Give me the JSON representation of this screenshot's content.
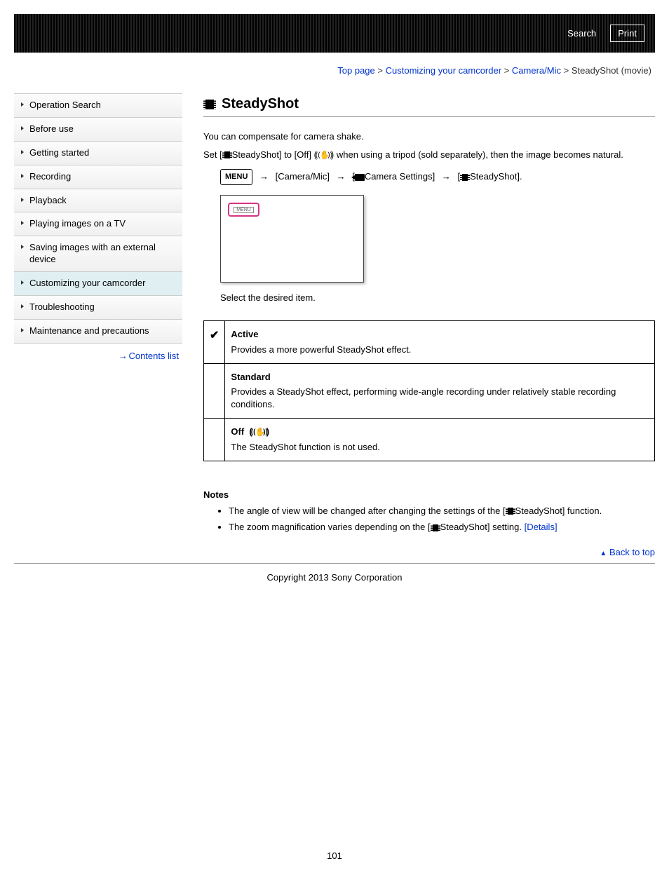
{
  "header": {
    "search": "Search",
    "print": "Print"
  },
  "breadcrumb": {
    "top": "Top page",
    "sep": ">",
    "l1": "Customizing your camcorder",
    "l2": "Camera/Mic",
    "current": "SteadyShot (movie)"
  },
  "sidebar": {
    "items": [
      "Operation Search",
      "Before use",
      "Getting started",
      "Recording",
      "Playback",
      "Playing images on a TV",
      "Saving images with an external device",
      "Customizing your camcorder",
      "Troubleshooting",
      "Maintenance and precautions"
    ],
    "contents_list": "Contents list"
  },
  "content": {
    "title": "SteadyShot",
    "p1": "You can compensate for camera shake.",
    "p2a": "Set [",
    "p2b": "SteadyShot] to [Off] (",
    "p2c": ") when using a tripod (sold separately), then the image becomes natural.",
    "menu_label": "MENU",
    "path1": "[Camera/Mic]",
    "path2a": "[",
    "path2b": "Camera Settings]",
    "path3a": "[",
    "path3b": "SteadyShot].",
    "screen_tag": "MENU",
    "caption": "Select the desired item.",
    "options": [
      {
        "mark": "✔",
        "name": "Active",
        "desc": "Provides a more powerful SteadyShot effect."
      },
      {
        "mark": "",
        "name": "Standard",
        "desc": "Provides a SteadyShot effect, performing wide-angle recording under relatively stable recording conditions."
      },
      {
        "mark": "",
        "name": "Off",
        "icon": true,
        "desc": "The SteadyShot function is not used."
      }
    ],
    "notes_title": "Notes",
    "notes": [
      {
        "a": "The angle of view will be changed after changing the settings of the [",
        "b": "SteadyShot] function."
      },
      {
        "a": "The zoom magnification varies depending on the [",
        "b": "SteadyShot] setting. ",
        "link": "[Details]"
      }
    ],
    "back_to_top": "Back to top"
  },
  "footer": {
    "copyright": "Copyright 2013 Sony Corporation",
    "page": "101"
  }
}
